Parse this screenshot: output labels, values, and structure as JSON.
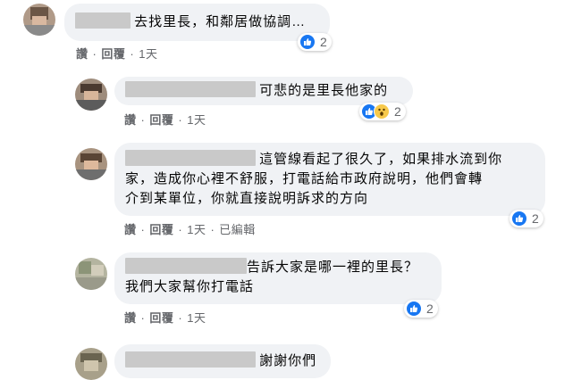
{
  "comments": [
    {
      "text": "去找里長，和鄰居做協調…",
      "actions": [
        "讚",
        "回覆",
        "1天"
      ],
      "reaction_count": "2",
      "reactions": [
        "like"
      ]
    },
    {
      "text": "可悲的是里長他家的",
      "actions": [
        "讚",
        "回覆",
        "1天"
      ],
      "reaction_count": "2",
      "reactions": [
        "like",
        "wow"
      ]
    },
    {
      "lines": [
        "這管線看起了很久了，如果排水流到你",
        "家，造成你心裡不舒服，打電話給市政府說明，他們會轉",
        "介到某單位，你就直接說明訴求的方向"
      ],
      "actions": [
        "讚",
        "回覆",
        "1天",
        "已編輯"
      ],
      "reaction_count": "2",
      "reactions": [
        "like"
      ]
    },
    {
      "lines": [
        "告訴大家是哪一裡的里長？",
        "我們大家幫你打電話"
      ],
      "actions": [
        "讚",
        "回覆",
        "1天"
      ],
      "reaction_count": "2",
      "reactions": [
        "like"
      ]
    },
    {
      "text": "謝謝你們"
    }
  ],
  "colors": {
    "bubble_bg": "#f0f2f5",
    "meta_text": "#65676b",
    "like_blue": "#1877f2",
    "wow_yellow": "#f7c94b"
  }
}
